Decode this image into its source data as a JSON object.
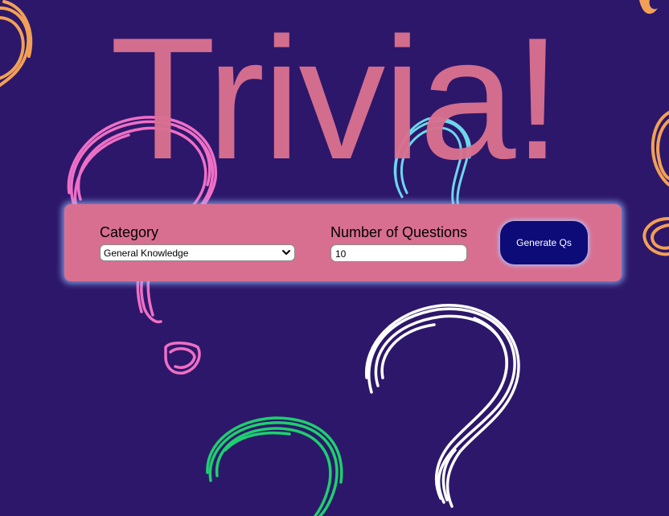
{
  "page": {
    "title": "Trivia!"
  },
  "form": {
    "category": {
      "label": "Category",
      "selected": "General Knowledge"
    },
    "num_questions": {
      "label": "Number of Questions",
      "value": "10"
    },
    "submit_label": "Generate Qs"
  },
  "colors": {
    "background": "#2d176a",
    "title": "#d97090",
    "panel": "#d96f90",
    "button": "#0d0b78"
  },
  "icons": {
    "select_arrow": "chevron-down-icon"
  },
  "decorations": [
    "orange-question-mark-top-left",
    "orange-question-mark-top-right",
    "orange-question-mark-right",
    "pink-question-mark",
    "cyan-question-mark",
    "white-question-mark",
    "green-question-mark"
  ]
}
